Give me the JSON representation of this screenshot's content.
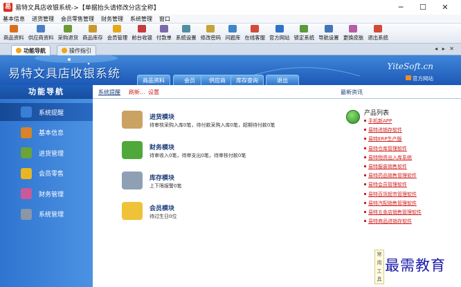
{
  "window": {
    "title": "易特文具店收银系统->【单据抬头请修改分店全称】",
    "min_glyph": "─",
    "max_glyph": "☐",
    "close_glyph": "✕"
  },
  "menu": [
    "基本信息",
    "进货管理",
    "会员零售管理",
    "财务管理",
    "系统管理",
    "窗口"
  ],
  "toolbar": [
    {
      "label": "商品资料",
      "color": "#d96f1e"
    },
    {
      "label": "供应商资料",
      "color": "#4a7fc8"
    },
    {
      "label": "采购退货",
      "color": "#6e9a35"
    },
    {
      "label": "商品库存",
      "color": "#c89a2e"
    },
    {
      "label": "会员管理",
      "color": "#e6a817"
    },
    {
      "label": "前台收银",
      "color": "#c43c3c"
    },
    {
      "label": "付款单",
      "color": "#7c6aa8"
    },
    {
      "label": "系统设置",
      "color": "#4f8f9f"
    },
    {
      "label": "修改密码",
      "color": "#c8a23a"
    },
    {
      "label": "问题库",
      "color": "#3d86c9"
    },
    {
      "label": "在线客服",
      "color": "#d34a3a"
    },
    {
      "label": "官方网站",
      "color": "#2f73c9"
    },
    {
      "label": "锁定系统",
      "color": "#5a9a3c"
    },
    {
      "label": "导航设置",
      "color": "#4474b8"
    },
    {
      "label": "更换皮肤",
      "color": "#b55da8"
    },
    {
      "label": "退出系统",
      "color": "#d24a34"
    }
  ],
  "tabs": [
    {
      "label": "功能导航",
      "active": true
    },
    {
      "label": "操作指引",
      "active": false
    }
  ],
  "tab_controls": "◂ ▸ ✕",
  "banner": {
    "title": "易特文具店收银系统",
    "site": "YiteSoft.cn",
    "home_link": "官方网站",
    "nav_tabs": [
      "商品资料",
      "会员",
      "供应商",
      "库存查询",
      "退出"
    ]
  },
  "sidebar": {
    "title": "功能导航",
    "items": [
      {
        "label": "系统提醒",
        "active": true,
        "color": "#3b7ed6"
      },
      {
        "label": "基本信息",
        "active": false,
        "color": "#d9832a"
      },
      {
        "label": "进货管理",
        "active": false,
        "color": "#6aa33a"
      },
      {
        "label": "会员零售",
        "active": false,
        "color": "#e8b622"
      },
      {
        "label": "财务管理",
        "active": false,
        "color": "#c95a9a"
      },
      {
        "label": "系统管理",
        "active": false,
        "color": "#8a97a8"
      }
    ]
  },
  "crumbs": {
    "current": "系统提醒",
    "refresh": "刷新...",
    "settings": "设置",
    "news": "最新资讯"
  },
  "modules": [
    {
      "title": "进货模块",
      "desc": "待审核采购入库0笔，待付款采购入库0笔，超期待付款0笔",
      "color": "#caa264"
    },
    {
      "title": "财务模块",
      "desc": "待审收入0笔，待审支出0笔，待审核付款0笔",
      "color": "#4fa83a"
    },
    {
      "title": "库存模块",
      "desc": "上下限报警0笔",
      "color": "#8fa0b5"
    },
    {
      "title": "会员模块",
      "desc": "待过生日0位",
      "color": "#f0c23a"
    }
  ],
  "products": {
    "title": "产品列表",
    "items": [
      "手机新APP",
      "易特进销存软件",
      "易特ERP生产版",
      "易特仓库管理软件",
      "易特物资出入库系统",
      "易特服装销售软件",
      "易特药品销售管理软件",
      "易特会员管理软件",
      "易特百货超市管理软件",
      "易特汽配销售管理软件",
      "易特五金店销售管理软件",
      "易特商品进销存软件"
    ]
  },
  "side_nub": "常用工具",
  "watermark": "最需教育"
}
